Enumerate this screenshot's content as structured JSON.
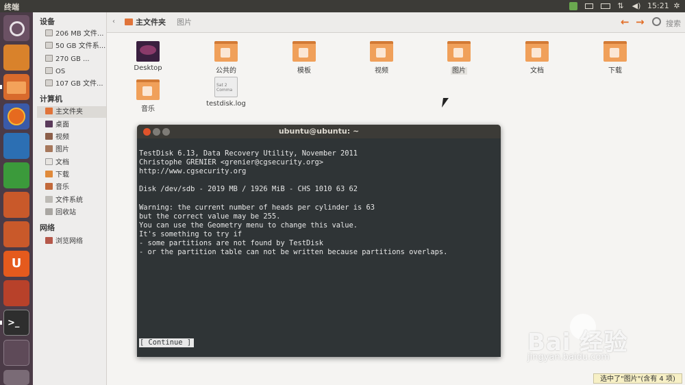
{
  "top_panel": {
    "app_title": "终端",
    "clock": "15:21",
    "icons": [
      "chip-icon",
      "mail-icon",
      "battery-icon",
      "network-icon",
      "sound-icon",
      "gear-icon"
    ],
    "sound_glyph": "◀)",
    "network_glyph": "⇅",
    "gear_glyph": "✲"
  },
  "launcher": {
    "icons": [
      "ubuntu-dash-icon",
      "installer-icon",
      "files-icon",
      "firefox-icon",
      "writer-icon",
      "calc-icon",
      "impress-icon",
      "software-center-icon",
      "ubuntu-one-icon",
      "settings-icon",
      "terminal-icon",
      "workspace-icon",
      "trash-icon"
    ],
    "terminal_glyph": ">_",
    "ubuntu_one_glyph": "U"
  },
  "sidebar": {
    "devices_header": "设备",
    "devices": [
      {
        "label": "206 MB 文件..."
      },
      {
        "label": "50 GB 文件系..."
      },
      {
        "label": "270 GB ..."
      },
      {
        "label": "OS"
      },
      {
        "label": "107 GB 文件..."
      }
    ],
    "computer_header": "计算机",
    "computer": [
      {
        "label": "主文件夹"
      },
      {
        "label": "桌面"
      },
      {
        "label": "视频"
      },
      {
        "label": "图片"
      },
      {
        "label": "文档"
      },
      {
        "label": "下载"
      },
      {
        "label": "音乐"
      },
      {
        "label": "文件系统"
      },
      {
        "label": "回收站"
      }
    ],
    "network_header": "网络",
    "network": [
      {
        "label": "浏览网络"
      }
    ]
  },
  "toolbar": {
    "back_glyph": "‹",
    "crumb_home": "主文件夹",
    "crumb_pictures": "图片",
    "search_label": "搜索"
  },
  "files": [
    {
      "label": "Desktop"
    },
    {
      "label": "公共的"
    },
    {
      "label": "模板"
    },
    {
      "label": "视频"
    },
    {
      "label": "图片"
    },
    {
      "label": "文档"
    },
    {
      "label": "下载"
    },
    {
      "label": "音乐"
    },
    {
      "label": "testdisk.log",
      "file_text": "Sat 2\nComma"
    }
  ],
  "terminal": {
    "title": "ubuntu@ubuntu: ~",
    "lines": [
      "TestDisk 6.13, Data Recovery Utility, November 2011",
      "Christophe GRENIER <grenier@cgsecurity.org>",
      "http://www.cgsecurity.org",
      "",
      "Disk /dev/sdb - 2019 MB / 1926 MiB - CHS 1010 63 62",
      "",
      "Warning: the current number of heads per cylinder is 63",
      "but the correct value may be 255.",
      "You can use the Geometry menu to change this value.",
      "It's something to try if",
      "- some partitions are not found by TestDisk",
      "- or the partition table can not be written because partitions overlaps."
    ],
    "continue_label": "[ Continue ]"
  },
  "watermark": {
    "logo": "Bai 经验",
    "url": "jingyan.baidu.com"
  },
  "status_bar": "选中了\"图片\"(含有 4 项)"
}
